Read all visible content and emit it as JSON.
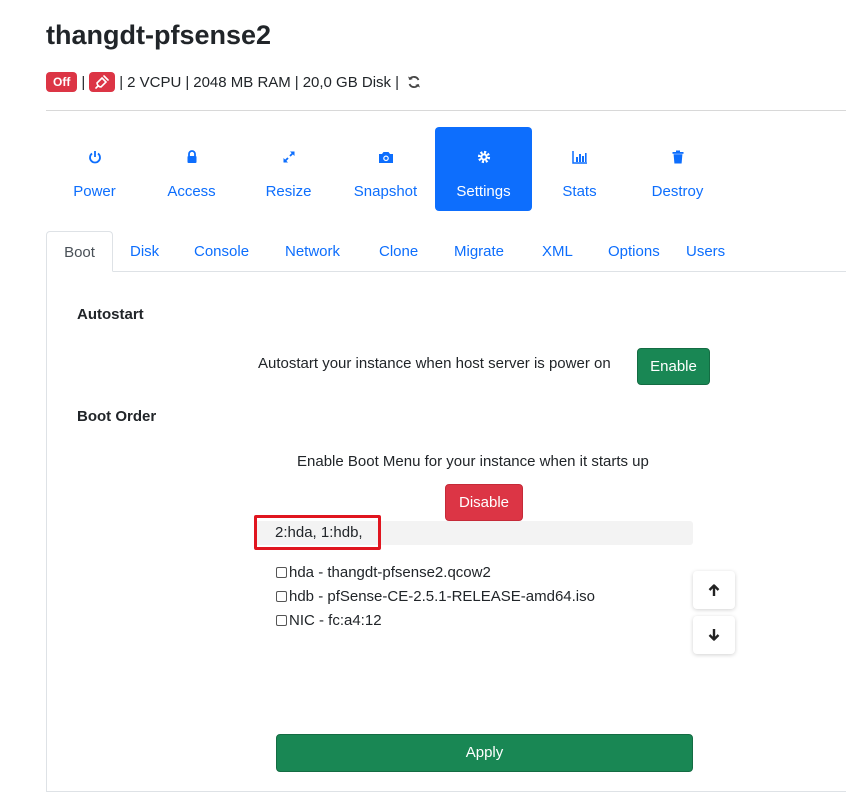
{
  "vm": {
    "name": "thangdt-pfsense2",
    "status_badge": "Off",
    "vcpu": "2 VCPU",
    "ram": "2048 MB RAM",
    "disk": "20,0 GB Disk",
    "separator": "|"
  },
  "actions": [
    {
      "label": "Power",
      "icon": "power-icon"
    },
    {
      "label": "Access",
      "icon": "lock-icon"
    },
    {
      "label": "Resize",
      "icon": "expand-icon"
    },
    {
      "label": "Snapshot",
      "icon": "camera-icon"
    },
    {
      "label": "Settings",
      "icon": "gear-icon",
      "active": true
    },
    {
      "label": "Stats",
      "icon": "bar-chart-icon"
    },
    {
      "label": "Destroy",
      "icon": "trash-icon"
    }
  ],
  "tabs": [
    {
      "label": "Boot",
      "active": true
    },
    {
      "label": "Disk"
    },
    {
      "label": "Console"
    },
    {
      "label": "Network"
    },
    {
      "label": "Clone"
    },
    {
      "label": "Migrate"
    },
    {
      "label": "XML"
    },
    {
      "label": "Options"
    },
    {
      "label": "Users"
    }
  ],
  "autostart": {
    "heading": "Autostart",
    "description": "Autostart your instance when host server is power on",
    "button_label": "Enable"
  },
  "boot_order": {
    "heading": "Boot Order",
    "description": "Enable Boot Menu for your instance when it starts up",
    "button_label": "Disable",
    "order_value": "2:hda, 1:hdb,",
    "devices": [
      {
        "label": "hda - thangdt-pfsense2.qcow2",
        "checked": false
      },
      {
        "label": "hdb - pfSense-CE-2.5.1-RELEASE-amd64.iso",
        "checked": false
      },
      {
        "label": "NIC - fc:a4:12",
        "checked": false
      }
    ],
    "apply_label": "Apply"
  },
  "colors": {
    "primary": "#0d6efd",
    "success": "#198754",
    "danger": "#dc3545",
    "highlight_box": "#e0151f"
  }
}
